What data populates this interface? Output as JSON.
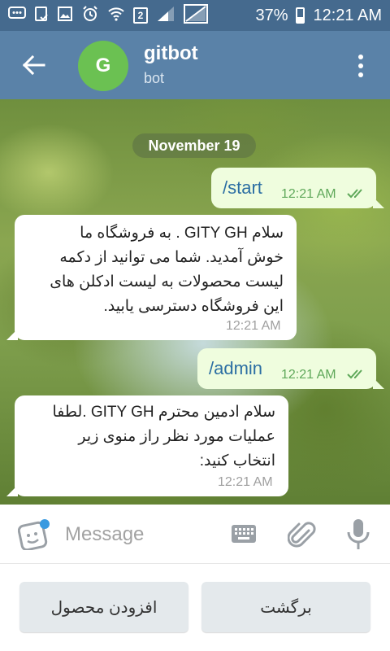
{
  "status_bar": {
    "sim_indicator": "2",
    "battery": "37%",
    "time": "12:21 AM"
  },
  "header": {
    "avatar_letter": "G",
    "title": "gitbot",
    "subtitle": "bot"
  },
  "chat": {
    "date_label": "November 19",
    "messages": [
      {
        "direction": "out",
        "text": "/start",
        "time": "12:21 AM"
      },
      {
        "direction": "in",
        "lines": [
          "سلام GITY GH . به فروشگاه ما",
          "خوش آمدید. شما می توانید از دکمه",
          "لیست محصولات به لیست ادکلن های",
          "این فروشگاه دسترسی یابید."
        ],
        "time": "12:21 AM"
      },
      {
        "direction": "out",
        "text": "/admin",
        "time": "12:21 AM"
      },
      {
        "direction": "in",
        "lines": [
          "سلام ادمین محترم GITY GH .لطفا",
          "عملیات مورد نظر راز منوی زیر",
          "انتخاب کنید:"
        ],
        "time": "12:21 AM"
      }
    ]
  },
  "composer": {
    "placeholder": "Message"
  },
  "bot_keyboard": {
    "buttons": [
      "افزودن محصول",
      "برگشت"
    ]
  },
  "colors": {
    "status_bar": "#456a8e",
    "app_bar": "#5a82a8",
    "avatar": "#6bc152",
    "outgoing_bubble": "#effdde",
    "incoming_bubble": "#ffffff",
    "command_text": "#2b6ea3",
    "read_check": "#5fa85a",
    "unread_dot": "#3a9ae0"
  },
  "icons": {
    "status": [
      "messages-icon",
      "clipboard-check-icon",
      "image-icon",
      "alarm-icon",
      "wifi-icon",
      "sim2-icon",
      "signal-icon",
      "battery-icon"
    ],
    "header": [
      "back-arrow-icon",
      "more-vertical-icon"
    ],
    "composer": [
      "sticker-icon",
      "keyboard-icon",
      "paperclip-icon",
      "microphone-icon"
    ]
  }
}
